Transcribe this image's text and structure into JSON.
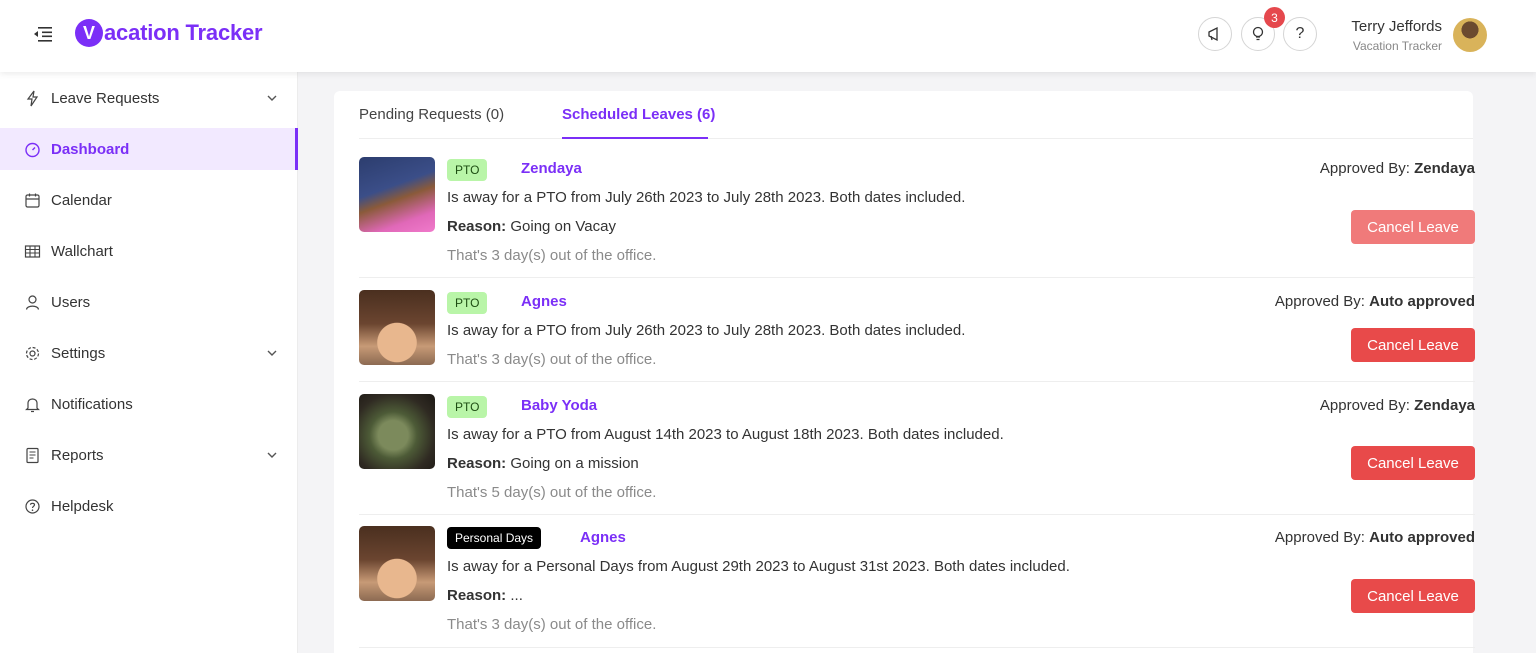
{
  "header": {
    "app_name": "Vacation Tracker",
    "logo_letter": "V",
    "logo_rest": "acation Tracker",
    "notification_count": "3",
    "help_glyph": "?",
    "user_name": "Terry Jeffords",
    "user_workspace": "Vacation Tracker"
  },
  "sidebar": {
    "items": [
      {
        "label": "Leave Requests",
        "icon": "bolt-icon",
        "has_chevron": true
      },
      {
        "label": "Dashboard",
        "icon": "dashboard-icon",
        "active": true
      },
      {
        "label": "Calendar",
        "icon": "calendar-icon"
      },
      {
        "label": "Wallchart",
        "icon": "table-icon"
      },
      {
        "label": "Users",
        "icon": "user-icon"
      },
      {
        "label": "Settings",
        "icon": "gear-icon",
        "has_chevron": true
      },
      {
        "label": "Notifications",
        "icon": "bell-icon"
      },
      {
        "label": "Reports",
        "icon": "report-icon",
        "has_chevron": true
      },
      {
        "label": "Helpdesk",
        "icon": "help-circle-icon"
      }
    ]
  },
  "tabs": {
    "pending": "Pending Requests (0)",
    "scheduled": "Scheduled Leaves (6)"
  },
  "leaves": [
    {
      "type": "PTO",
      "name": "Zendaya",
      "description": "Is away for a PTO from July 26th 2023 to July 28th 2023. Both dates included.",
      "reason_label": "Reason:",
      "reason": "Going on Vacay",
      "days": "That's 3 day(s) out of the office.",
      "approved_label": "Approved By:",
      "approved_by": "Zendaya",
      "cancel_label": "Cancel Leave"
    },
    {
      "type": "PTO",
      "name": "Agnes",
      "description": "Is away for a PTO from July 26th 2023 to July 28th 2023. Both dates included.",
      "days": "That's 3 day(s) out of the office.",
      "approved_label": "Approved By:",
      "approved_by": "Auto approved",
      "cancel_label": "Cancel Leave"
    },
    {
      "type": "PTO",
      "name": "Baby Yoda",
      "description": "Is away for a PTO from August 14th 2023 to August 18th 2023. Both dates included.",
      "reason_label": "Reason:",
      "reason": "Going on a mission",
      "days": "That's 5 day(s) out of the office.",
      "approved_label": "Approved By:",
      "approved_by": "Zendaya",
      "cancel_label": "Cancel Leave"
    },
    {
      "type": "Personal Days",
      "name": "Agnes",
      "description": "Is away for a Personal Days from August 29th 2023 to August 31st 2023. Both dates included.",
      "reason_label": "Reason:",
      "reason": "...",
      "days": "That's 3 day(s) out of the office.",
      "approved_label": "Approved By:",
      "approved_by": "Auto approved",
      "cancel_label": "Cancel Leave"
    }
  ],
  "colors": {
    "brand": "#7b2ff7",
    "danger": "#e84a4a",
    "pto_tag": "#b9f5a8"
  }
}
